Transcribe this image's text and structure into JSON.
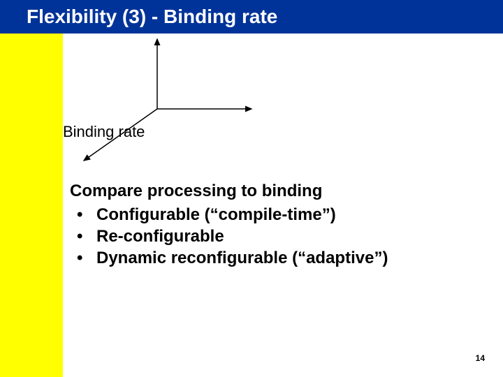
{
  "title": "Flexibility (3) - Binding rate",
  "axis_label": "Binding rate",
  "content": {
    "heading": "Compare processing to binding",
    "bullets": [
      "Configurable (“compile-time”)",
      "Re-configurable",
      "Dynamic reconfigurable (“adaptive”)"
    ]
  },
  "page_number": "14"
}
